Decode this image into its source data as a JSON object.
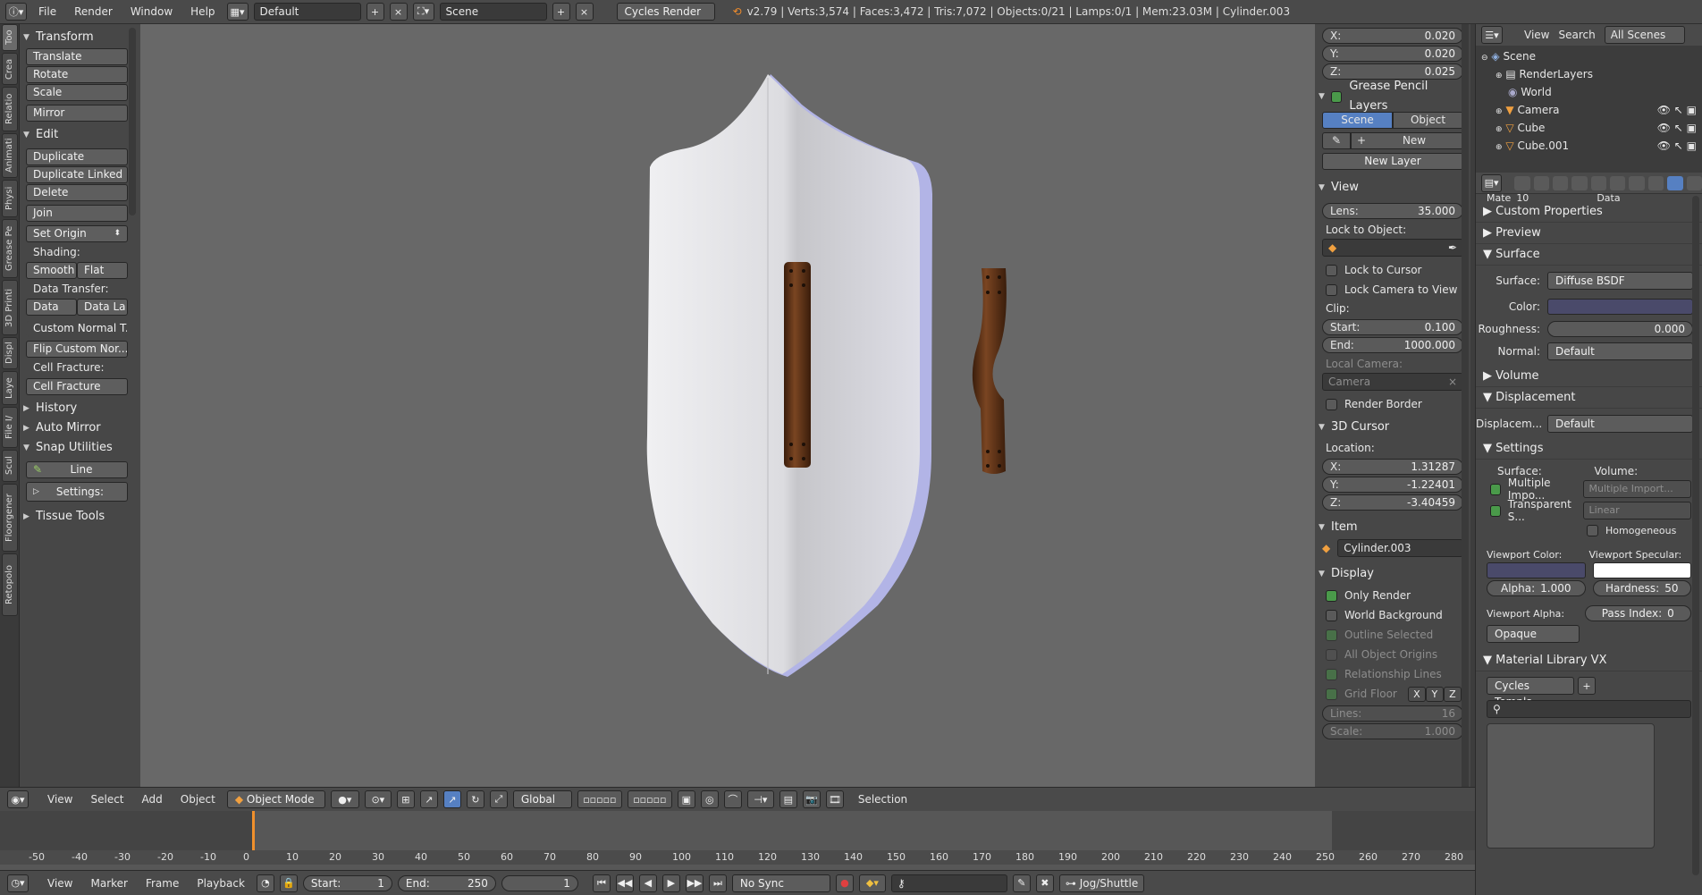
{
  "top_bar": {
    "menus": [
      "File",
      "Render",
      "Window",
      "Help"
    ],
    "layout": "Default",
    "scene": "Scene",
    "engine": "Cycles Render",
    "stats": "v2.79 | Verts:3,574 | Faces:3,472 | Tris:7,072 | Objects:0/21 | Lamps:0/1 | Mem:23.03M | Cylinder.003"
  },
  "tool_tabs": [
    "Too",
    "Crea",
    "Relatio",
    "Animati",
    "Physi",
    "Grease Pe",
    "3D Printi",
    "Displ",
    "Laye",
    "File I/",
    "Scul",
    "Floorgener",
    "Retopolo"
  ],
  "tools": {
    "transform": {
      "title": "Transform",
      "buttons": [
        "Translate",
        "Rotate",
        "Scale",
        "Mirror"
      ]
    },
    "edit": {
      "title": "Edit",
      "buttons": [
        "Duplicate",
        "Duplicate Linked",
        "Delete",
        "Join"
      ],
      "set_origin": "Set Origin",
      "shading_label": "Shading:",
      "smooth": "Smooth",
      "flat": "Flat",
      "data_transfer_label": "Data Transfer:",
      "data": "Data",
      "data_la": "Data La",
      "custom_normal": "Custom Normal T...",
      "flip_custom": "Flip Custom Nor...",
      "cell_fracture_label": "Cell Fracture:",
      "cell_fracture": "Cell Fracture"
    },
    "history": "History",
    "auto_mirror": "Auto Mirror",
    "snap_utilities": "Snap Utilities",
    "line": "Line",
    "settings": "Settings:",
    "tissue_tools": "Tissue Tools"
  },
  "n_panel": {
    "location": {
      "x": "0.020",
      "y": "0.020",
      "z": "0.025"
    },
    "grease_pencil": {
      "title": "Grease Pencil Layers",
      "scene": "Scene",
      "object": "Object",
      "new": "New",
      "new_layer": "New Layer"
    },
    "view": {
      "title": "View",
      "lens_label": "Lens:",
      "lens": "35.000",
      "lock_to_object": "Lock to Object:",
      "lock_to_cursor": "Lock to Cursor",
      "lock_camera": "Lock Camera to View",
      "clip": "Clip:",
      "start_label": "Start:",
      "start": "0.100",
      "end_label": "End:",
      "end": "1000.000",
      "local_camera": "Local Camera:",
      "camera": "Camera",
      "render_border": "Render Border"
    },
    "cursor": {
      "title": "3D Cursor",
      "location": "Location:",
      "x": "1.31287",
      "y": "-1.22401",
      "z": "-3.40459"
    },
    "item": {
      "title": "Item",
      "name": "Cylinder.003"
    },
    "display": {
      "title": "Display",
      "only_render": "Only Render",
      "world_background": "World Background",
      "outline_selected": "Outline Selected",
      "all_origins": "All Object Origins",
      "relationship_lines": "Relationship Lines",
      "grid_floor": "Grid Floor",
      "x": "X",
      "y": "Y",
      "z": "Z",
      "lines_label": "Lines:",
      "lines": "16",
      "scale_label": "Scale:",
      "scale": "1.000"
    }
  },
  "outliner": {
    "menus": [
      "View",
      "Search"
    ],
    "filter": "All Scenes",
    "items": [
      "Scene",
      "RenderLayers",
      "World",
      "Camera",
      "Cube",
      "Cube.001"
    ]
  },
  "properties": {
    "partial": "Mate",
    "slot": "10",
    "data": "Data",
    "custom_properties": "Custom Properties",
    "preview": "Preview",
    "surface_section": "Surface",
    "surface_label": "Surface:",
    "surface_value": "Diffuse BSDF",
    "color_label": "Color:",
    "roughness_label": "Roughness:",
    "roughness": "0.000",
    "normal_label": "Normal:",
    "normal_value": "Default",
    "volume": "Volume",
    "displacement": "Displacement",
    "displacement_label": "Displacem...",
    "displacement_value": "Default",
    "settings": "Settings",
    "surface_col": "Surface:",
    "volume_col": "Volume:",
    "multiple_importance": "Multiple Impo...",
    "multiple_importance_vol": "Multiple Import...",
    "transparent_shadows": "Transparent S...",
    "linear": "Linear",
    "homogeneous": "Homogeneous",
    "viewport_color": "Viewport Color:",
    "viewport_specular": "Viewport Specular:",
    "alpha_label": "Alpha:",
    "alpha": "1.000",
    "hardness_label": "Hardness:",
    "hardness": "50",
    "viewport_alpha": "Viewport Alpha:",
    "pass_index_label": "Pass Index:",
    "pass_index": "0",
    "opaque": "Opaque",
    "material_library": "Material Library VX",
    "cycles_template": "Cycles Templa"
  },
  "view3d_header": {
    "menus": [
      "View",
      "Select",
      "Add",
      "Object"
    ],
    "mode": "Object Mode",
    "orientation": "Global",
    "selection": "Selection"
  },
  "timeline": {
    "ticks": [
      "-50",
      "-40",
      "-30",
      "-20",
      "-10",
      "0",
      "10",
      "20",
      "30",
      "40",
      "50",
      "60",
      "70",
      "80",
      "90",
      "100",
      "110",
      "120",
      "130",
      "140",
      "150",
      "160",
      "170",
      "180",
      "190",
      "200",
      "210",
      "220",
      "230",
      "240",
      "250",
      "260",
      "270",
      "280"
    ],
    "current_frame": 0,
    "menus": [
      "View",
      "Marker",
      "Frame",
      "Playback"
    ],
    "start_label": "Start:",
    "start": "1",
    "end_label": "End:",
    "end": "250",
    "frame": "1",
    "sync": "No Sync",
    "jog": "Jog/Shuttle"
  },
  "colors": {
    "selected_tab": "#5680c2",
    "checkbox_on": "#4a9a4a",
    "shield_face": "#d8d8dc",
    "strap": "#6b3a1b"
  }
}
